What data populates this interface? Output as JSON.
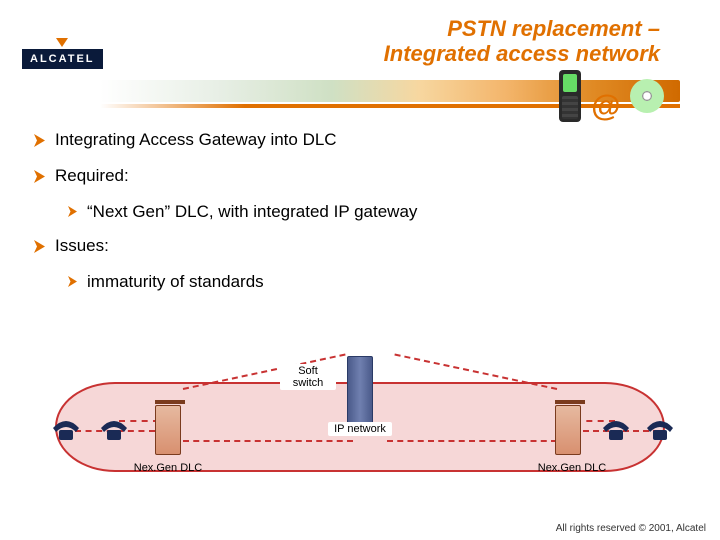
{
  "brand": {
    "name": "ALCATEL"
  },
  "title": {
    "line1": "PSTN replacement –",
    "line2": "Integrated access network"
  },
  "bullets": {
    "b1": "Integrating Access Gateway into DLC",
    "b2": "Required:",
    "b2_1": "“Next Gen” DLC, with integrated IP gateway",
    "b3": "Issues:",
    "b3_1": "immaturity of standards"
  },
  "diagram": {
    "soft_switch": "Soft switch",
    "ip_network": "IP network",
    "nexgen_dlc_left": "Nex.Gen DLC",
    "nexgen_dlc_right": "Nex.Gen DLC"
  },
  "footer": "All rights reserved © 2001, Alcatel",
  "colors": {
    "accent": "#e07000",
    "cloud_fill": "#f6d7d7",
    "cloud_border": "#c83232"
  }
}
